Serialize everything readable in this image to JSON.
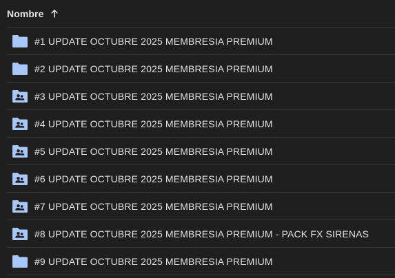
{
  "header": {
    "column_label": "Nombre",
    "sort_icon": "arrow-up-icon"
  },
  "colors": {
    "background": "#1f1f1f",
    "text": "#e3e3e3",
    "folder": "#a8c7fa",
    "folder_shared_glyph": "#1f1f1f",
    "divider": "#3a3a3a"
  },
  "files": [
    {
      "name": "#1 UPDATE OCTUBRE 2025 MEMBRESIA PREMIUM",
      "icon": "folder-icon"
    },
    {
      "name": "#2 UPDATE OCTUBRE 2025 MEMBRESIA PREMIUM",
      "icon": "folder-icon"
    },
    {
      "name": "#3 UPDATE OCTUBRE 2025 MEMBRESIA PREMIUM",
      "icon": "shared-folder-icon"
    },
    {
      "name": "#4 UPDATE OCTUBRE 2025 MEMBRESIA PREMIUM",
      "icon": "shared-folder-icon"
    },
    {
      "name": "#5 UPDATE OCTUBRE 2025 MEMBRESIA PREMIUM",
      "icon": "shared-folder-icon"
    },
    {
      "name": "#6 UPDATE OCTUBRE 2025 MEMBRESIA PREMIUM",
      "icon": "shared-folder-icon"
    },
    {
      "name": "#7 UPDATE OCTUBRE 2025 MEMBRESIA PREMIUM",
      "icon": "shared-folder-icon"
    },
    {
      "name": "#8 UPDATE OCTUBRE 2025 MEMBRESIA PREMIUM - PACK FX SIRENAS",
      "icon": "shared-folder-icon"
    },
    {
      "name": "#9 UPDATE OCTUBRE 2025 MEMBRESIA PREMIUM",
      "icon": "folder-icon"
    }
  ]
}
